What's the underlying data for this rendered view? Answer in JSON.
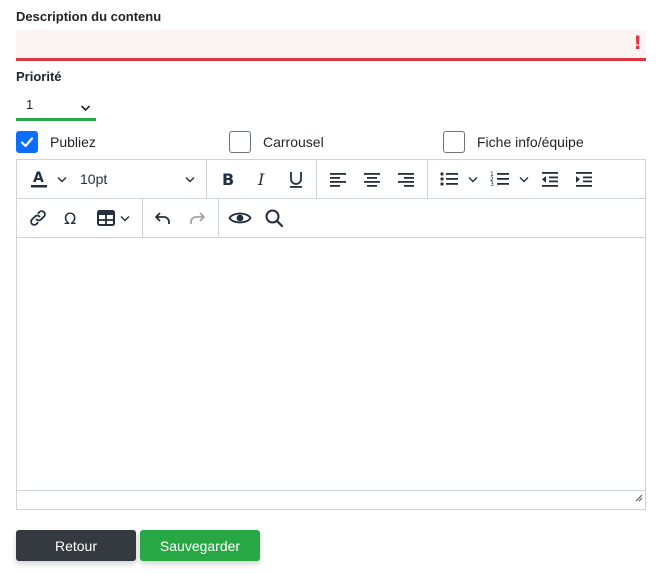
{
  "form": {
    "description_label": "Description du contenu",
    "description_value": "",
    "description_error_mark": "!",
    "priority_label": "Priorité",
    "priority_value": "1"
  },
  "checkboxes": {
    "publish": {
      "label": "Publiez",
      "checked": true
    },
    "carousel": {
      "label": "Carrousel",
      "checked": false
    },
    "info_sheet": {
      "label": "Fiche info/équipe",
      "checked": false
    }
  },
  "editor": {
    "font_size": "10pt",
    "content": "",
    "toolbar_icons": [
      "text-color-icon",
      "font-size-select",
      "bold-icon",
      "italic-icon",
      "underline-icon",
      "align-left-icon",
      "align-center-icon",
      "align-right-icon",
      "bullet-list-icon",
      "numbered-list-icon",
      "outdent-icon",
      "indent-icon",
      "link-icon",
      "special-char-icon",
      "table-icon",
      "undo-icon",
      "redo-icon",
      "preview-icon",
      "search-icon"
    ]
  },
  "buttons": {
    "back_label": "Retour",
    "save_label": "Sauvegarder"
  },
  "colors": {
    "error": "#dc3545",
    "success": "#28a745",
    "primary": "#0d6efd",
    "dark": "#343a40"
  }
}
